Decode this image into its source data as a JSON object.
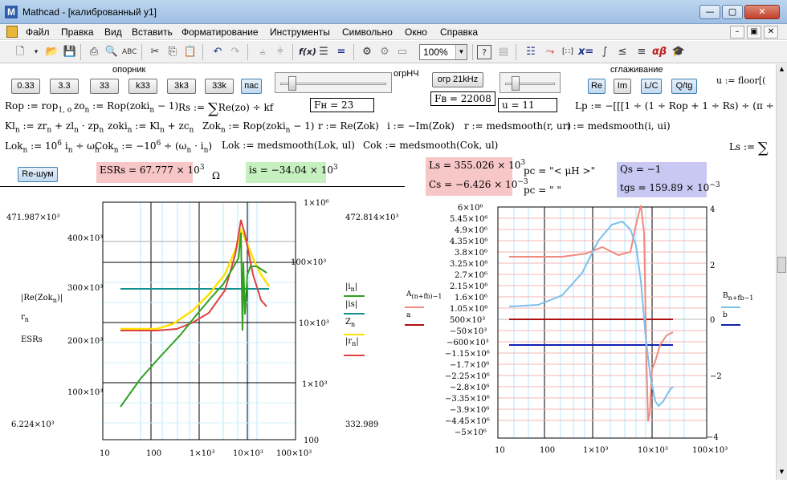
{
  "window": {
    "title": "Mathcad - [калиброванный у1]",
    "app_icon": "M",
    "controls": [
      "—",
      "▢",
      "✕"
    ]
  },
  "menu": {
    "items": [
      "Файл",
      "Правка",
      "Вид",
      "Вставить",
      "Форматирование",
      "Инструменты",
      "Символьно",
      "Окно",
      "Справка"
    ],
    "mdi_controls": [
      "–",
      "▣",
      "✕"
    ]
  },
  "toolbar": {
    "zoom": "100%",
    "math_symbols": [
      "x=",
      "αβ"
    ]
  },
  "controls": {
    "opornik_label": "опорник",
    "buttons": [
      "0.33",
      "3.3",
      "33",
      "k33",
      "3k3",
      "33k",
      "пас"
    ],
    "ogrnch_label": "огрНЧ",
    "ogr_btn": "огр 21kHz",
    "fv": "Fв = 22008",
    "sglazhivanie_label": "сглаживание",
    "smooth_buttons": [
      "Re",
      "Im",
      "L/C",
      "Q/tg"
    ],
    "u_expr": "u := floor[(",
    "re_shum": "Re-шум"
  },
  "exprs": {
    "rop": "Rop := rop",
    "rop_sub": "1, o",
    "zo": "zo",
    "zo_rhs": ":= Rop(zoki",
    "zo_rhs2": "− 1)",
    "rs": "Rs :=",
    "rs_rhs": "Re(zo) ÷ kf",
    "fn": "Fн = 23",
    "u_val": "u = 11",
    "lp": "Lp := −[[[1 ÷ (1 ÷ Rop + 1 ÷ Rs) ÷ (π ÷ 2)] ·",
    "kl": "Kl",
    "kl_rhs": ":= zr",
    "kl_rhs2": "+ zl",
    "kl_rhs3": "· zp",
    "zoki": "zoki",
    "zoki_rhs": ":= Kl",
    "zoki_rhs2": "+ zc",
    "zok": "Zok",
    "zok_rhs": ":= Rop(zoki",
    "zok_rhs2": "− 1)",
    "r_expr": "r := Re(Zok)",
    "i_expr": "i := −Im(Zok)",
    "r_smooth": "r := medsmooth(r, ur)",
    "i_smooth": "i := medsmooth(i, ui)",
    "lok": "Lok",
    "lok_rhs": ":= 10",
    "lok_rhs2": "i",
    "lok_rhs3": "÷ ω",
    "cok": "Cok",
    "cok_rhs": ":= −10",
    "cok_rhs2": "÷ (ω",
    "cok_rhs3": "· i",
    "cok_rhs4": ")",
    "lok_smooth": "Lok := medsmooth(Lok, ul)",
    "cok_smooth": "Cok := medsmooth(Cok, ul)",
    "ls_def": "Ls :=",
    "sub_n": "n",
    "sup_6": "6",
    "esrs": "ESRs = 67.777 × 10",
    "esrs_exp": "3",
    "omega": "Ω",
    "is": "is = −34.04 × 10",
    "is_exp": "3",
    "ls": "Ls = 355.026 × 10",
    "ls_exp": "3",
    "cs": "Cs = −6.426 × 10",
    "cs_exp": "−3",
    "pc1": "pc = \"<   μH   >\"",
    "pc2": "pc = \"               \"",
    "qs": "Qs = −1",
    "tgs": "tgs = 159.89 × 10",
    "tgs_exp": "−3"
  },
  "plot_left": {
    "y_left_ticks": [
      "400×10³",
      "300×10³",
      "200×10³",
      "100×10³"
    ],
    "y_right_ticks": [
      "1×10⁶",
      "100×10³",
      "10×10³",
      "1×10³",
      "100"
    ],
    "x_ticks": [
      "10",
      "100",
      "1×10³",
      "10×10³",
      "100×10³"
    ],
    "top_left_val": "471.987×10³",
    "bottom_left_val": "6.224×10³",
    "top_right_val": "472.814×10³",
    "bottom_right_val": "332.989",
    "y_labels": [
      "|Re(Zok",
      "n",
      ")|",
      "r",
      "n",
      "ESRs"
    ],
    "legend": [
      "|i",
      "n",
      "|",
      "|is|",
      "Z",
      "n",
      "|r",
      "n",
      "|"
    ]
  },
  "plot_right": {
    "y_left_ticks": [
      "6×10⁶",
      "5.45×10⁶",
      "4.9×10⁶",
      "4.35×10⁶",
      "3.8×10⁶",
      "3.25×10⁶",
      "2.7×10⁶",
      "2.15×10⁶",
      "1.6×10⁶",
      "1.05×10⁶",
      "500×10³",
      "−50×10³",
      "−600×10³",
      "−1.15×10⁶",
      "−1.7×10⁶",
      "−2.25×10⁶",
      "−2.8×10⁶",
      "−3.35×10⁶",
      "−3.9×10⁶",
      "−4.45×10⁶",
      "−5×10⁶"
    ],
    "y_right_ticks": [
      "4",
      "2",
      "0",
      "−2",
      "−4"
    ],
    "x_ticks": [
      "10",
      "100",
      "1×10³",
      "10×10³",
      "100×10³"
    ],
    "left_legend": [
      "A",
      "(n+fb)−1",
      "a"
    ],
    "right_legend": [
      "B",
      "n+fb−1",
      "b"
    ]
  }
}
